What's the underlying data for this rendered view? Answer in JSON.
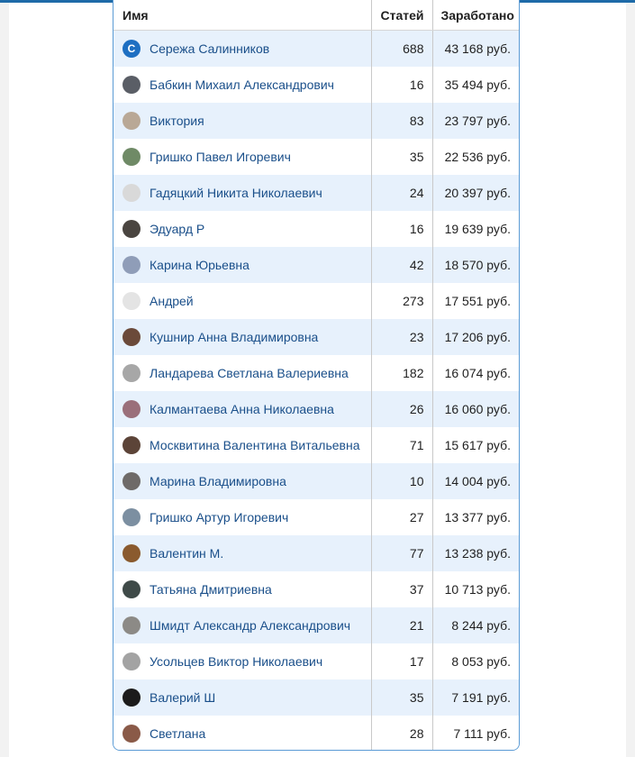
{
  "table": {
    "headers": {
      "name": "Имя",
      "articles": "Статей",
      "earned": "Заработано"
    },
    "rows": [
      {
        "name": "Сережа Салинников",
        "articles": "688",
        "earned": "43 168 руб.",
        "avatar_letter": "С",
        "avatar_color": "#1e6fc2"
      },
      {
        "name": "Бабкин Михаил Александрович",
        "articles": "16",
        "earned": "35 494 руб.",
        "avatar_letter": "",
        "avatar_color": "#5a5e66"
      },
      {
        "name": "Виктория",
        "articles": "83",
        "earned": "23 797 руб.",
        "avatar_letter": "",
        "avatar_color": "#b9a896"
      },
      {
        "name": "Гришко Павел Игоревич",
        "articles": "35",
        "earned": "22 536 руб.",
        "avatar_letter": "",
        "avatar_color": "#6f8a66"
      },
      {
        "name": "Гадяцкий Никита Николаевич",
        "articles": "24",
        "earned": "20 397 руб.",
        "avatar_letter": "",
        "avatar_color": "#d9d9d9"
      },
      {
        "name": "Эдуард Р",
        "articles": "16",
        "earned": "19 639 руб.",
        "avatar_letter": "",
        "avatar_color": "#4a4540"
      },
      {
        "name": "Карина Юрьевна",
        "articles": "42",
        "earned": "18 570 руб.",
        "avatar_letter": "",
        "avatar_color": "#8f9db8"
      },
      {
        "name": "Андрей",
        "articles": "273",
        "earned": "17 551 руб.",
        "avatar_letter": "",
        "avatar_color": "#e4e4e4"
      },
      {
        "name": "Кушнир Анна Владимировна",
        "articles": "23",
        "earned": "17 206 руб.",
        "avatar_letter": "",
        "avatar_color": "#6b4a3a"
      },
      {
        "name": "Ландарева Светлана Валериевна",
        "articles": "182",
        "earned": "16 074 руб.",
        "avatar_letter": "",
        "avatar_color": "#a7a7a7"
      },
      {
        "name": "Калмантаева Анна Николаевна",
        "articles": "26",
        "earned": "16 060 руб.",
        "avatar_letter": "",
        "avatar_color": "#9a6f7a"
      },
      {
        "name": "Москвитина Валентина Витальевна",
        "articles": "71",
        "earned": "15 617 руб.",
        "avatar_letter": "",
        "avatar_color": "#5c4438"
      },
      {
        "name": "Марина Владимировна",
        "articles": "10",
        "earned": "14 004 руб.",
        "avatar_letter": "",
        "avatar_color": "#6e6a68"
      },
      {
        "name": "Гришко Артур Игоревич",
        "articles": "27",
        "earned": "13 377 руб.",
        "avatar_letter": "",
        "avatar_color": "#7c8fa1"
      },
      {
        "name": "Валентин М.",
        "articles": "77",
        "earned": "13 238 руб.",
        "avatar_letter": "",
        "avatar_color": "#8a5a2e"
      },
      {
        "name": "Татьяна Дмитриевна",
        "articles": "37",
        "earned": "10 713 руб.",
        "avatar_letter": "",
        "avatar_color": "#3f4a48"
      },
      {
        "name": "Шмидт Александр Александрович",
        "articles": "21",
        "earned": "8 244 руб.",
        "avatar_letter": "",
        "avatar_color": "#8c8a86"
      },
      {
        "name": "Усольцев Виктор Николаевич",
        "articles": "17",
        "earned": "8 053 руб.",
        "avatar_letter": "",
        "avatar_color": "#a3a3a3"
      },
      {
        "name": "Валерий Ш",
        "articles": "35",
        "earned": "7 191 руб.",
        "avatar_letter": "",
        "avatar_color": "#1b1b1b"
      },
      {
        "name": "Светлана",
        "articles": "28",
        "earned": "7 111 руб.",
        "avatar_letter": "",
        "avatar_color": "#8a5a48"
      }
    ]
  }
}
